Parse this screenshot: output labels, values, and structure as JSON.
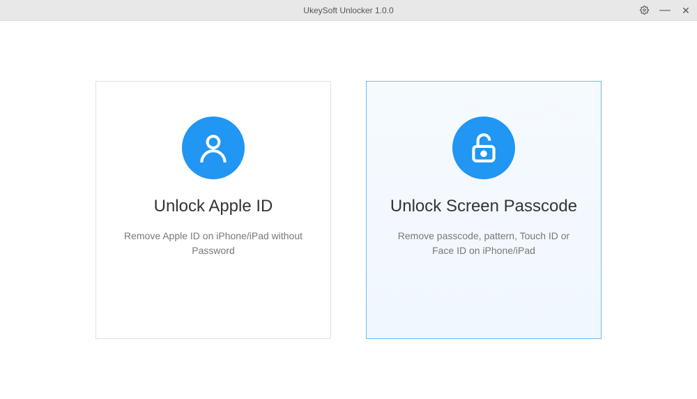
{
  "window": {
    "title": "UkeySoft Unlocker 1.0.0"
  },
  "options": {
    "appleId": {
      "title": "Unlock Apple ID",
      "description": "Remove Apple ID on iPhone/iPad without Password"
    },
    "screenPasscode": {
      "title": "Unlock Screen Passcode",
      "description": "Remove passcode, pattern, Touch ID or Face ID on iPhone/iPad"
    }
  }
}
